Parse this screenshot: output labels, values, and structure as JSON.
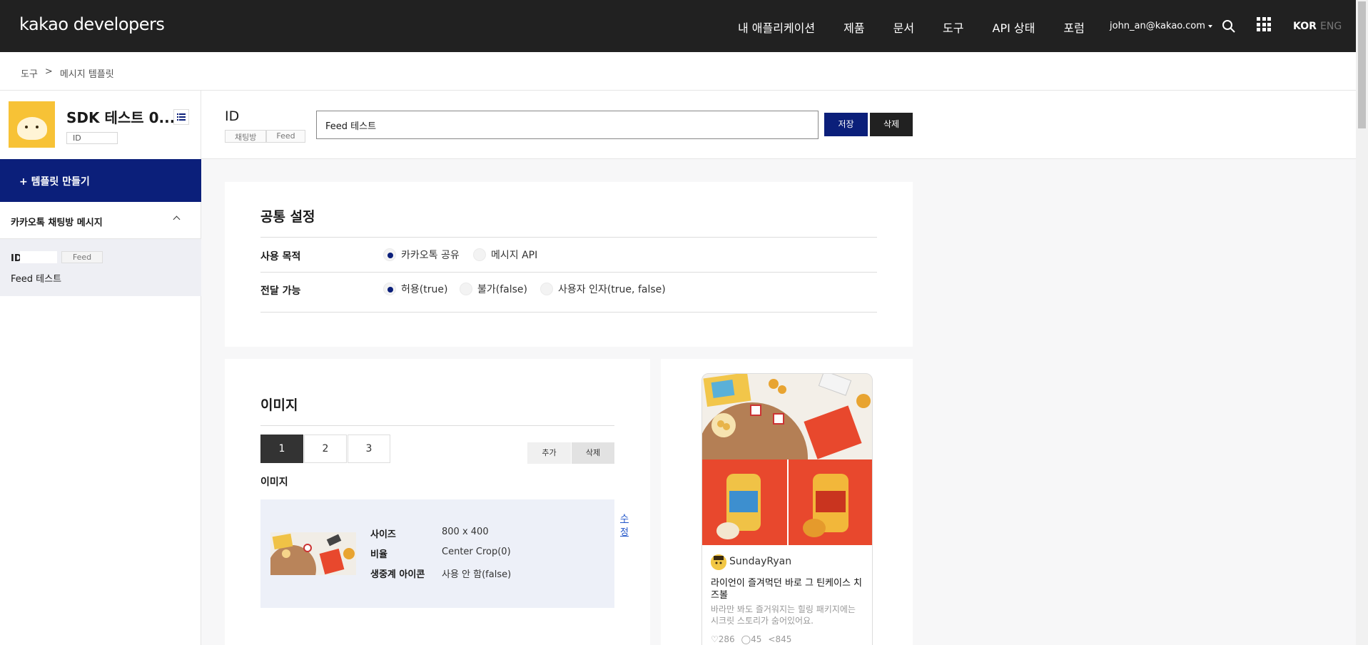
{
  "nav": {
    "logo_bold": "kakao",
    "logo_rest": " developers",
    "items": [
      "내 애플리케이션",
      "제품",
      "문서",
      "도구",
      "API 상태",
      "포럼"
    ],
    "user": "john_an@kakao.com",
    "lang_active": "KOR",
    "lang_other": "ENG"
  },
  "breadcrumb": [
    "도구",
    ">",
    "메시지 템플릿"
  ],
  "sidebar": {
    "app_name": "SDK 테스트 0...",
    "app_id_label": "ID",
    "make_template": "+ 템플릿 만들기",
    "section_title": "카카오톡 채팅방 메시지",
    "template": {
      "id_label": "ID",
      "type": "Feed",
      "name": "Feed 테스트"
    }
  },
  "header": {
    "id_label": "ID",
    "tags": [
      "채팅방",
      "Feed"
    ],
    "title_value": "Feed 테스트",
    "save": "저장",
    "delete": "삭제"
  },
  "common": {
    "title": "공통 설정",
    "purpose_label": "사용 목적",
    "purpose_options": [
      "카카오톡 공유",
      "메시지 API"
    ],
    "forward_label": "전달 가능",
    "forward_options": [
      "허용(true)",
      "불가(false)",
      "사용자 인자(true, false)"
    ]
  },
  "image_section": {
    "title": "이미지",
    "tabs": [
      "1",
      "2",
      "3"
    ],
    "add": "추가",
    "delete": "삭제",
    "sub_title": "이미지",
    "edit": "수정",
    "info": [
      {
        "label": "사이즈",
        "value": "800 x 400"
      },
      {
        "label": "비율",
        "value": "Center Crop(0)"
      },
      {
        "label": "생중계 아이콘",
        "value": "사용 안 함(false)"
      }
    ]
  },
  "preview": {
    "author": "SundayRyan",
    "title": "라이언이 즐겨먹던 바로 그 틴케이스 치즈볼",
    "description": "바라만 봐도 즐거워지는 힐링 패키지에는 시크릿 스토리가 숨어있어요.",
    "likes": "286",
    "comments": "45",
    "shares": "845"
  },
  "colors": {
    "brand_navy": "#0b1f7a",
    "nav_bg": "#212121",
    "accent_red": "#e8482d"
  }
}
